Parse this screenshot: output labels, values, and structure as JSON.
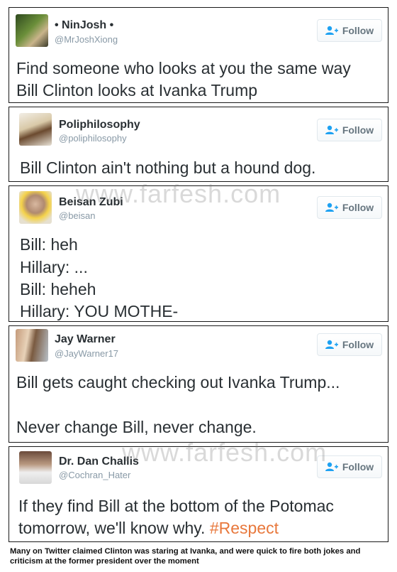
{
  "follow_label": "Follow",
  "tweets": [
    {
      "name": "• NinJosh •",
      "handle": "@MrJoshXiong",
      "lines": [
        "Find someone who looks at you the same way",
        "Bill Clinton looks at Ivanka Trump"
      ]
    },
    {
      "name": "Poliphilosophy",
      "handle": "@poliphilosophy",
      "lines": [
        "Bill Clinton ain't nothing but a hound dog."
      ]
    },
    {
      "name": "Beisan Zubi",
      "handle": "@beisan",
      "lines": [
        "Bill: heh",
        "Hillary: ...",
        "Bill: heheh",
        "Hillary: YOU MOTHE-"
      ]
    },
    {
      "name": "Jay Warner",
      "handle": "@JayWarner17",
      "lines": [
        "Bill gets caught checking out Ivanka Trump...",
        "Never change Bill, never change."
      ]
    },
    {
      "name": "Dr. Dan Challis",
      "handle": "@Cochran_Hater",
      "lines": [
        "If they find Bill at the bottom of the Potomac",
        "tomorrow, we'll know why."
      ],
      "hashtag": "#Respect"
    }
  ],
  "watermark": "www.farfesh.com",
  "caption": "Many on Twitter claimed Clinton was staring at Ivanka, and were quick to fire both jokes and criticism at the former president over the moment",
  "colors": {
    "hashtag": "#e8783c",
    "name": "#292f33",
    "handle": "#8899a6",
    "border": "#1a1a1a"
  }
}
